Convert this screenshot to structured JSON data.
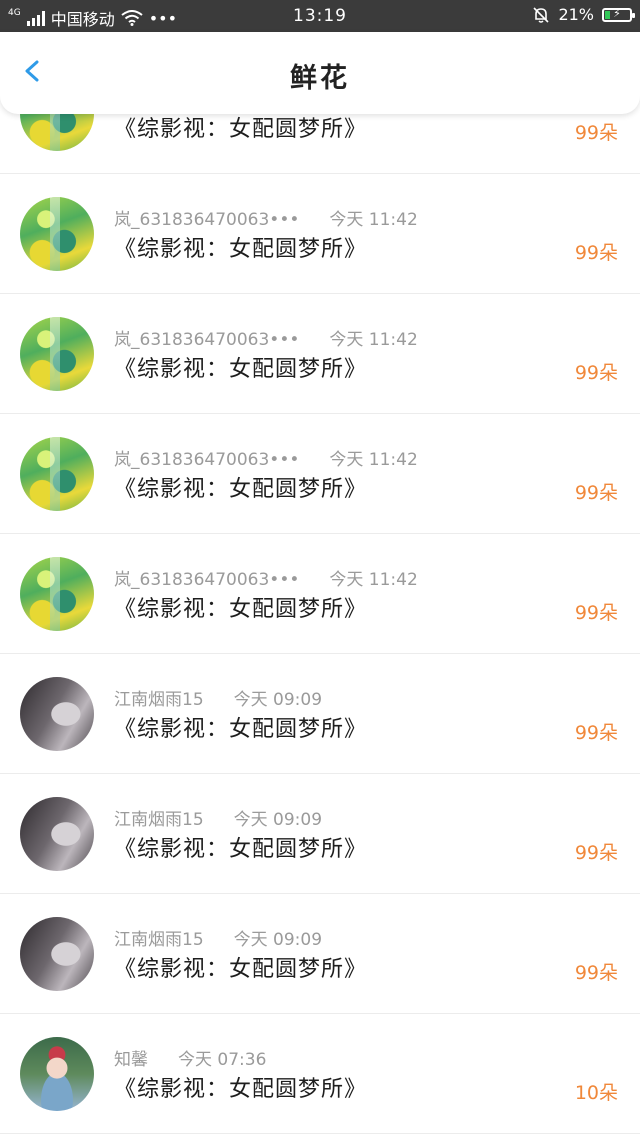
{
  "status_bar": {
    "network": "4G",
    "carrier": "中国移动",
    "dots": "•••",
    "time": "13:19",
    "battery": "21%",
    "battery_level": 0.21
  },
  "header": {
    "title": "鲜花"
  },
  "rows": [
    {
      "name": "",
      "time": "",
      "book": "《综影视：女配圆梦所》",
      "count": "99朵",
      "avatar": "green"
    },
    {
      "name": "岚_631836470063•••",
      "time": "今天 11:42",
      "book": "《综影视：女配圆梦所》",
      "count": "99朵",
      "avatar": "green"
    },
    {
      "name": "岚_631836470063•••",
      "time": "今天 11:42",
      "book": "《综影视：女配圆梦所》",
      "count": "99朵",
      "avatar": "green"
    },
    {
      "name": "岚_631836470063•••",
      "time": "今天 11:42",
      "book": "《综影视：女配圆梦所》",
      "count": "99朵",
      "avatar": "green"
    },
    {
      "name": "岚_631836470063•••",
      "time": "今天 11:42",
      "book": "《综影视：女配圆梦所》",
      "count": "99朵",
      "avatar": "green"
    },
    {
      "name": "江南烟雨15",
      "time": "今天 09:09",
      "book": "《综影视：女配圆梦所》",
      "count": "99朵",
      "avatar": "gray"
    },
    {
      "name": "江南烟雨15",
      "time": "今天 09:09",
      "book": "《综影视：女配圆梦所》",
      "count": "99朵",
      "avatar": "gray"
    },
    {
      "name": "江南烟雨15",
      "time": "今天 09:09",
      "book": "《综影视：女配圆梦所》",
      "count": "99朵",
      "avatar": "gray"
    },
    {
      "name": "知馨",
      "time": "今天 07:36",
      "book": "《综影视：女配圆梦所》",
      "count": "10朵",
      "avatar": "girl"
    }
  ],
  "colors": {
    "accent": "#f0883a",
    "back_arrow": "#2f9be8",
    "status_bar_bg": "#3b3b3b"
  }
}
